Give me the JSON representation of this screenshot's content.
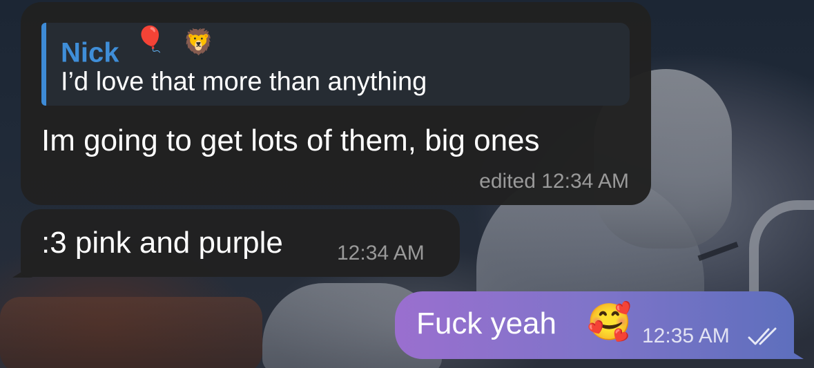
{
  "messages": [
    {
      "direction": "incoming",
      "reply": {
        "name": "Nick",
        "name_emojis": [
          "🎈",
          "🦁"
        ],
        "text": "I’d love that more than anything"
      },
      "text": "Im going to get lots of them, big ones",
      "meta": "edited 12:34 AM"
    },
    {
      "direction": "incoming",
      "text": ":3 pink and purple",
      "meta": "12:34 AM"
    },
    {
      "direction": "outgoing",
      "text": "Fuck yeah",
      "emoji": "🥰",
      "meta": "12:35 AM",
      "status_icon": "double-check-icon"
    }
  ],
  "colors": {
    "incoming_bubble": "#212121",
    "reply_accent": "#3f8ed8",
    "outgoing_gradient_start": "#9a6fcf",
    "outgoing_gradient_end": "#5e6fbd",
    "meta_text": "#9a9a9a"
  }
}
